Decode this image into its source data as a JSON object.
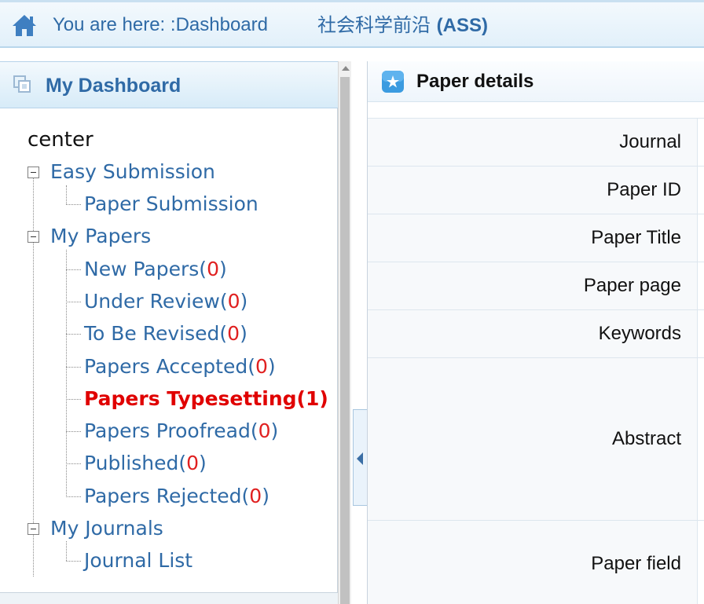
{
  "breadcrumb": {
    "prefix": "You are here: :Dashboard",
    "site_cn": "社会科学前沿 ",
    "site_abbr": "(ASS)"
  },
  "left_panel": {
    "title": "My Dashboard",
    "tree": {
      "root": "center",
      "groups": [
        {
          "label": "Easy Submission",
          "children": [
            {
              "label": "Paper Submission",
              "count": null
            }
          ]
        },
        {
          "label": "My Papers",
          "children": [
            {
              "label": "New Papers(",
              "count": "0",
              "suffix": ")"
            },
            {
              "label": "Under Review(",
              "count": "0",
              "suffix": ")"
            },
            {
              "label": "To Be Revised(",
              "count": "0",
              "suffix": ")"
            },
            {
              "label": "Papers Accepted(",
              "count": "0",
              "suffix": ")"
            },
            {
              "label": "Papers Typesetting(",
              "count": "1",
              "suffix": ")",
              "active": true
            },
            {
              "label": "Papers Proofread(",
              "count": "0",
              "suffix": ")"
            },
            {
              "label": "Published(",
              "count": "0",
              "suffix": ")"
            },
            {
              "label": "Papers Rejected(",
              "count": "0",
              "suffix": ")"
            }
          ]
        },
        {
          "label": "My Journals",
          "children": [
            {
              "label": "Journal List",
              "count": null
            }
          ]
        }
      ]
    }
  },
  "right_panel": {
    "title": "Paper details",
    "fields": [
      {
        "label": "Journal",
        "value": ""
      },
      {
        "label": "Paper ID",
        "value": ""
      },
      {
        "label": "Paper Title",
        "value": ""
      },
      {
        "label": "Paper page",
        "value": ""
      },
      {
        "label": "Keywords",
        "value": ""
      },
      {
        "label": "Abstract",
        "value": ""
      },
      {
        "label": "Paper field",
        "value": ""
      }
    ]
  },
  "colors": {
    "link": "#2f6aa6",
    "count": "#e02020",
    "active": "#e00000",
    "header_bg": "#e2f0fa"
  },
  "icons": [
    "home-icon",
    "dashboard-icon",
    "star-icon",
    "collapse-left-icon",
    "scroll-up-icon"
  ]
}
